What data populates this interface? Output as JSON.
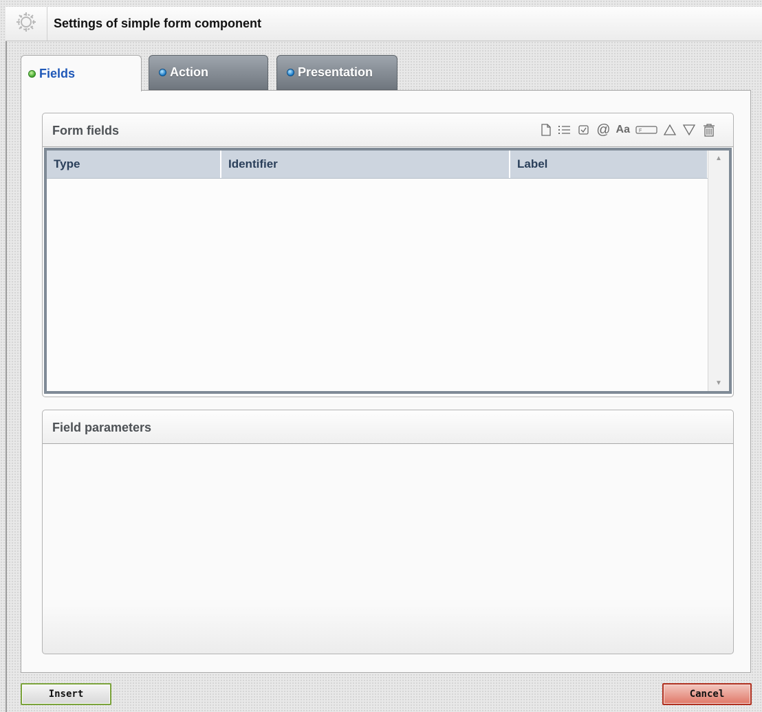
{
  "window": {
    "title": "Settings of simple form component",
    "icon": "gear-icon"
  },
  "tabs": [
    {
      "label": "Fields",
      "active": true,
      "indicator": "green"
    },
    {
      "label": "Action",
      "active": false,
      "indicator": "blue"
    },
    {
      "label": "Presentation",
      "active": false,
      "indicator": "blue"
    }
  ],
  "form_fields": {
    "title": "Form fields",
    "toolbar": [
      "new-field-icon",
      "list-icon",
      "checkbox-icon",
      "email-at-icon",
      "text-aa-icon",
      "file-input-icon",
      "move-up-icon",
      "move-down-icon",
      "trash-icon"
    ],
    "columns": [
      "Type",
      "Identifier",
      "Label"
    ],
    "rows": []
  },
  "field_parameters": {
    "title": "Field parameters"
  },
  "buttons": {
    "insert": "Insert",
    "cancel": "Cancel"
  },
  "colors": {
    "active_tab_text": "#1f58b8",
    "insert_border": "#7aa23a",
    "cancel_bg": "#e07868"
  }
}
